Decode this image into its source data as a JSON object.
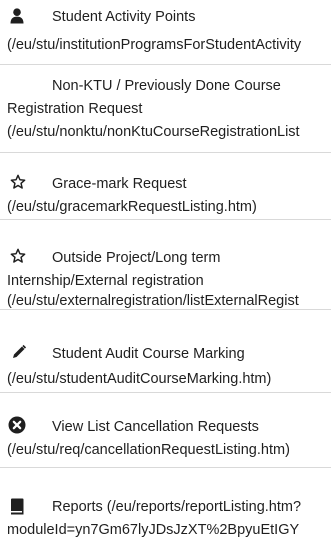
{
  "menu": {
    "items": [
      {
        "icon": "user-icon",
        "title": "Student Activity Points",
        "path": "(/eu/stu/institutionProgramsForStudentActivity"
      },
      {
        "icon": "",
        "title_line1": "Non-KTU / Previously Done Course",
        "title_line2": "Registration Request",
        "path": "(/eu/stu/nonktu/nonKtuCourseRegistrationList"
      },
      {
        "icon": "star-outline-icon",
        "title": "Grace-mark Request",
        "path": "(/eu/stu/gracemarkRequestListing.htm)"
      },
      {
        "icon": "star-outline-icon",
        "title_line1": "Outside Project/Long term",
        "title_line2": "Internship/External registration",
        "path": "(/eu/stu/externalregistration/listExternalRegist"
      },
      {
        "icon": "pencil-icon",
        "title": "Student Audit Course Marking",
        "path": "(/eu/stu/studentAuditCourseMarking.htm)"
      },
      {
        "icon": "cancel-circle-icon",
        "title": "View List Cancellation Requests",
        "path": "(/eu/stu/req/cancellationRequestListing.htm)"
      },
      {
        "icon": "book-icon",
        "title": "Reports (/eu/reports/reportListing.htm?",
        "path": "moduleId=yn7Gm67lyJDsJzXT%2BpyuEtIGY"
      }
    ]
  }
}
